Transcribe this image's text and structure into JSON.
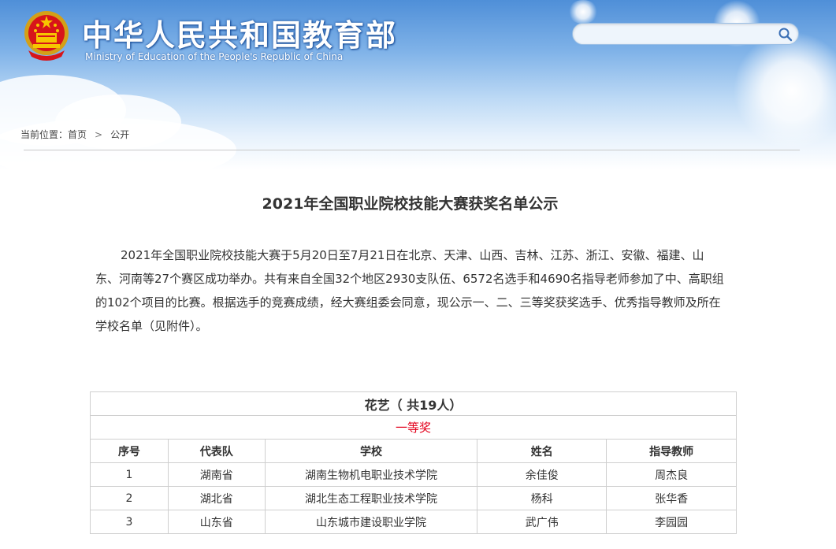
{
  "header": {
    "title": "中华人民共和国教育部",
    "subtitle": "Ministry of Education of the People's Republic of China",
    "search": {
      "placeholder": "",
      "value": ""
    }
  },
  "breadcrumb": {
    "label": "当前位置：",
    "items": [
      "首页",
      "公开"
    ]
  },
  "article": {
    "title": "2021年全国职业院校技能大赛获奖名单公示",
    "body": "2021年全国职业院校技能大赛于5月20日至7月21日在北京、天津、山西、吉林、江苏、浙江、安徽、福建、山东、河南等27个赛区成功举办。共有来自全国32个地区2930支队伍、6572名选手和4690名指导老师参加了中、高职组的102个项目的比赛。根据选手的竞赛成绩，经大赛组委会同意，现公示一、二、三等奖获奖选手、优秀指导教师及所在学校名单（见附件）。"
  },
  "table": {
    "category": "花艺（ 共19人）",
    "prize": "一等奖",
    "columns": [
      "序号",
      "代表队",
      "学校",
      "姓名",
      "指导教师"
    ],
    "rows": [
      [
        "1",
        "湖南省",
        "湖南生物机电职业技术学院",
        "余佳俊",
        "周杰良"
      ],
      [
        "2",
        "湖北省",
        "湖北生态工程职业技术学院",
        "杨科",
        "张华香"
      ],
      [
        "3",
        "山东省",
        "山东城市建设职业学院",
        "武广伟",
        "李园园"
      ]
    ]
  },
  "colors": {
    "prize_red": "#e3001b",
    "header_blue": "#4f8fd8"
  }
}
